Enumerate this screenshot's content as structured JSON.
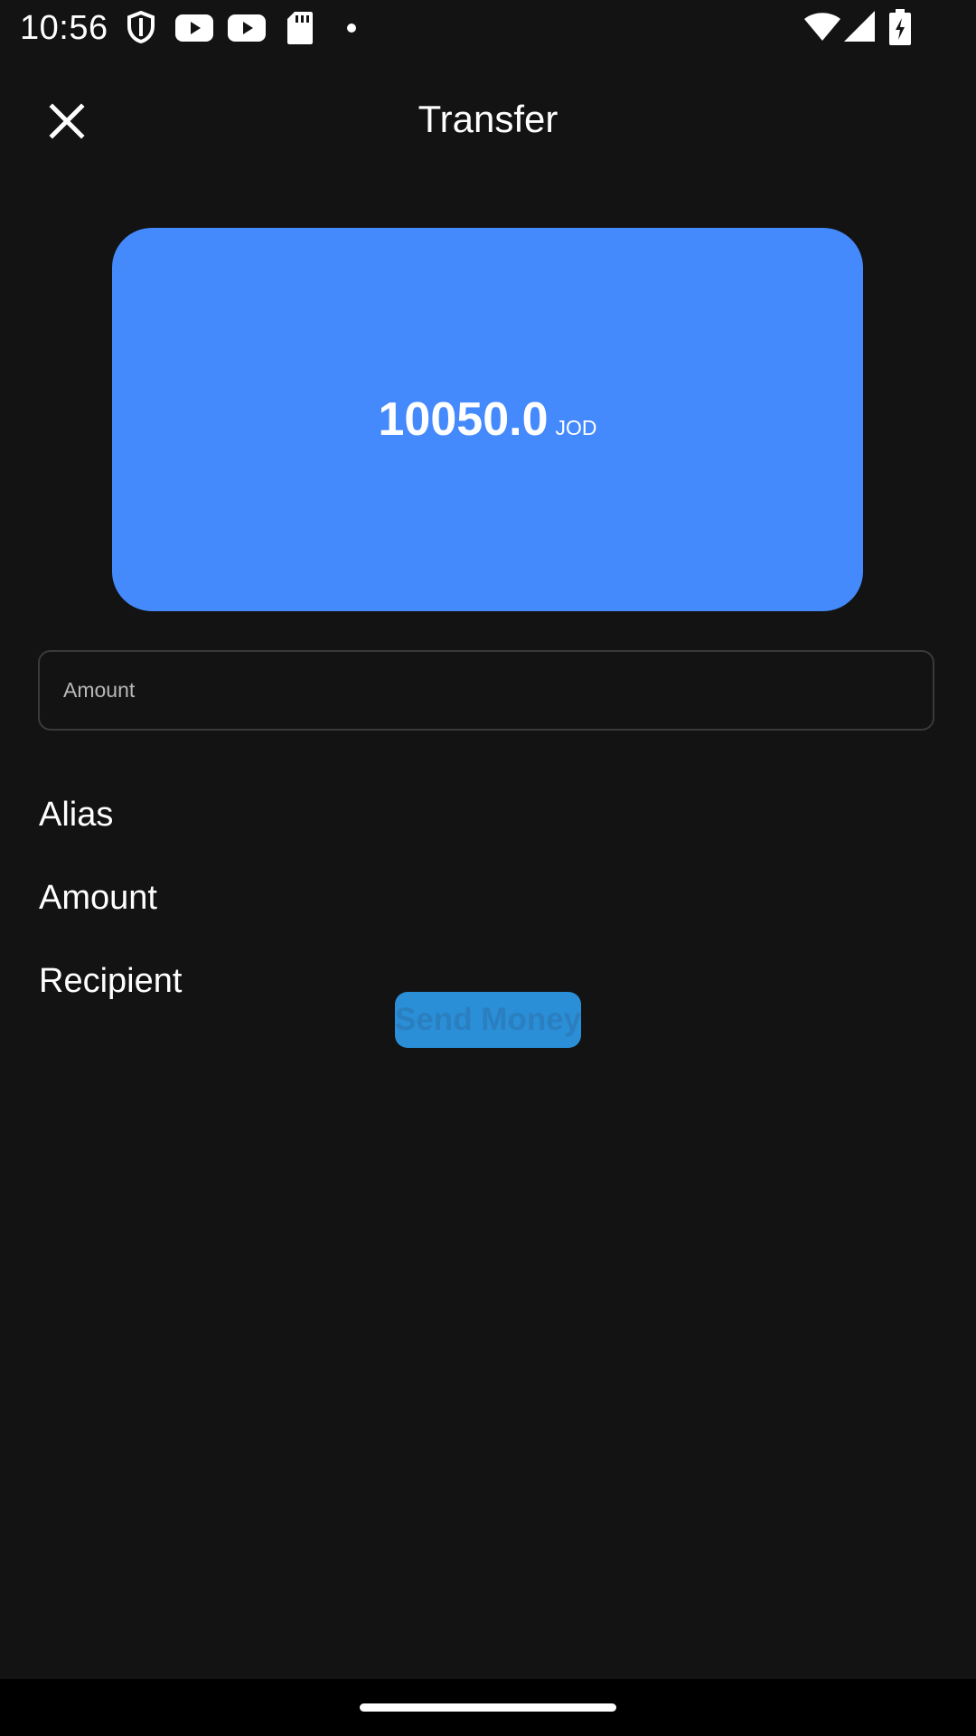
{
  "status_bar": {
    "time": "10:56",
    "icons": [
      "shield-icon",
      "youtube-icon",
      "youtube-icon",
      "sd-card-icon",
      "dot-icon",
      "wifi-icon",
      "signal-icon",
      "battery-charging-icon"
    ]
  },
  "app_bar": {
    "title": "Transfer",
    "close_icon": "close-icon"
  },
  "balance_card": {
    "amount": "10050.0",
    "currency": "JOD",
    "color": "#448afd"
  },
  "amount_field": {
    "placeholder": "Amount",
    "value": ""
  },
  "details": {
    "alias_label": "Alias",
    "amount_label": "Amount",
    "recipient_label": "Recipient"
  },
  "send_button": {
    "label": "Send Money",
    "color": "#2a8fd6"
  }
}
